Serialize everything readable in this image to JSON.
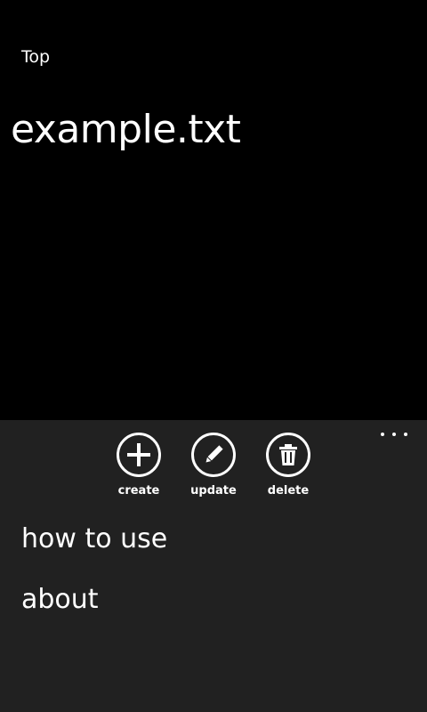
{
  "header": {
    "breadcrumb": "Top",
    "title": "example.txt"
  },
  "appbar": {
    "more_icon": "ellipsis-icon",
    "buttons": [
      {
        "label": "create",
        "icon": "plus-icon"
      },
      {
        "label": "update",
        "icon": "pencil-icon"
      },
      {
        "label": "delete",
        "icon": "trash-icon"
      }
    ],
    "menu_items": [
      {
        "label": "how to use"
      },
      {
        "label": "about"
      }
    ]
  },
  "colors": {
    "background": "#000000",
    "appbar": "#212121",
    "foreground": "#ffffff"
  }
}
